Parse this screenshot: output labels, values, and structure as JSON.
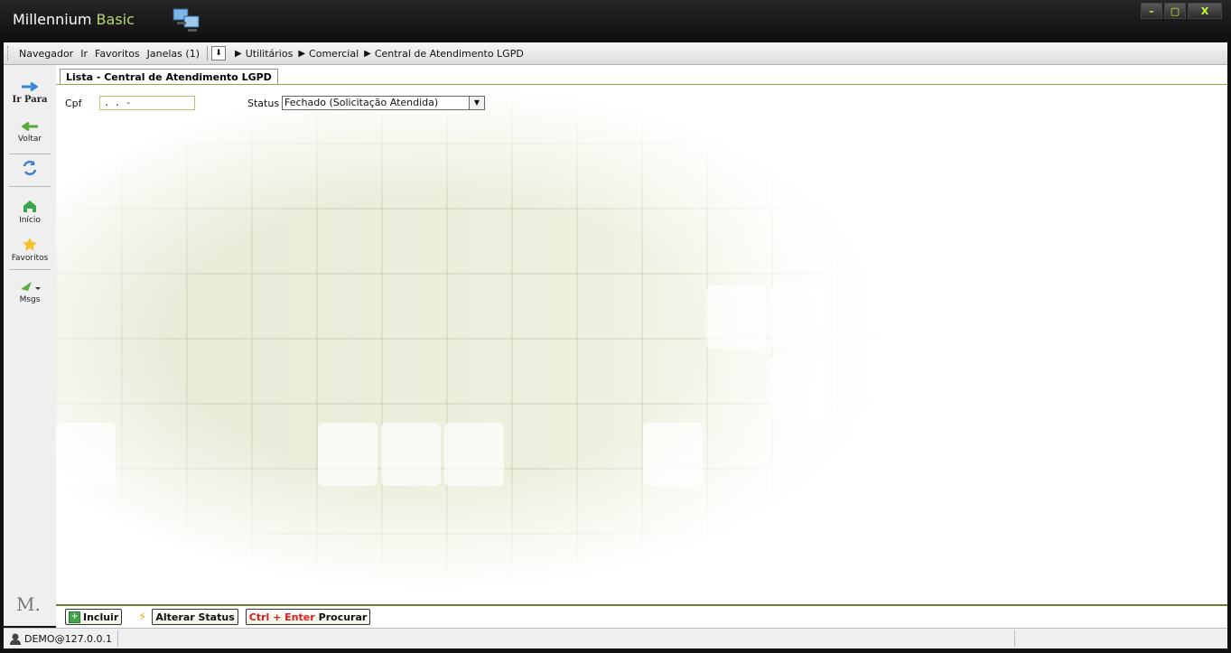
{
  "window": {
    "title_main": "Millennium",
    "title_accent": "Basic",
    "buttons": [
      "–",
      "▢",
      "X"
    ]
  },
  "menu": {
    "items": [
      {
        "label": "Navegador"
      },
      {
        "label": "Ir"
      },
      {
        "label": "Favoritos"
      },
      {
        "label": "Janelas (1)"
      }
    ],
    "breadcrumb": [
      "Utilitários",
      "Comercial",
      "Central de Atendimento LGPD"
    ]
  },
  "sidebar": {
    "items": [
      {
        "label": "Ir Para",
        "icon": "arrow-right-icon"
      },
      {
        "label": "Voltar",
        "icon": "arrow-left-icon"
      },
      {
        "label": "",
        "icon": "refresh-icon"
      },
      {
        "label": "Início",
        "icon": "home-icon"
      },
      {
        "label": "Favoritos",
        "icon": "star-icon"
      },
      {
        "label": "Msgs",
        "icon": "message-icon"
      }
    ],
    "logo": "M."
  },
  "tab": {
    "label": "Lista - Central de Atendimento LGPD"
  },
  "form": {
    "cpf_label": "Cpf",
    "cpf_value": " .   .   -",
    "status_label": "Status",
    "status_value": "Fechado (Solicitação Atendida)"
  },
  "actions": {
    "include": "Incluir",
    "alter_status": "Alterar Status",
    "search_shortcut": "Ctrl + Enter",
    "search": "Procurar"
  },
  "statusbar": {
    "user": "DEMO@127.0.0.1"
  }
}
